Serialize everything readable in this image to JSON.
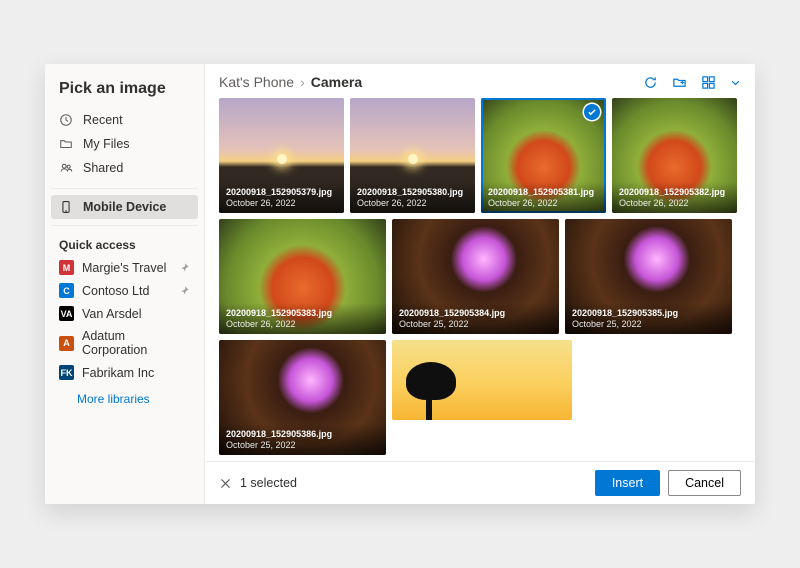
{
  "title": "Pick an image",
  "nav": {
    "recent": "Recent",
    "myfiles": "My Files",
    "shared": "Shared",
    "mobile": "Mobile Device"
  },
  "quick_access": {
    "label": "Quick access",
    "items": [
      {
        "label": "Margie's Travel",
        "tile": "M",
        "color": "#d13438",
        "pinned": true
      },
      {
        "label": "Contoso Ltd",
        "tile": "C",
        "color": "#0078d4",
        "pinned": true
      },
      {
        "label": "Van Arsdel",
        "tile": "VA",
        "color": "#000000",
        "pinned": false
      },
      {
        "label": "Adatum Corporation",
        "tile": "A",
        "color": "#ca5010",
        "pinned": false
      },
      {
        "label": "Fabrikam Inc",
        "tile": "FK",
        "color": "#004578",
        "pinned": false
      }
    ],
    "more": "More libraries"
  },
  "breadcrumb": [
    "Kat's Phone",
    "Camera"
  ],
  "thumbs": [
    {
      "name": "20200918_152905379.jpg",
      "date": "October 26, 2022",
      "art": "sunset",
      "selected": false,
      "row": 1
    },
    {
      "name": "20200918_152905380.jpg",
      "date": "October 26, 2022",
      "art": "sunset",
      "selected": false,
      "row": 1
    },
    {
      "name": "20200918_152905381.jpg",
      "date": "October 26, 2022",
      "art": "flower",
      "selected": true,
      "row": 1
    },
    {
      "name": "20200918_152905382.jpg",
      "date": "October 26, 2022",
      "art": "flower",
      "selected": false,
      "row": 1
    },
    {
      "name": "20200918_152905383.jpg",
      "date": "October 26, 2022",
      "art": "flower",
      "selected": false,
      "row": 2
    },
    {
      "name": "20200918_152905384.jpg",
      "date": "October 25, 2022",
      "art": "dome",
      "selected": false,
      "row": 2
    },
    {
      "name": "20200918_152905385.jpg",
      "date": "October 25, 2022",
      "art": "dome",
      "selected": false,
      "row": 2
    },
    {
      "name": "20200918_152905386.jpg",
      "date": "October 25, 2022",
      "art": "dome",
      "selected": false,
      "row": 2
    },
    {
      "name": "",
      "date": "",
      "art": "tree",
      "selected": false,
      "row": 3
    },
    {
      "name": "",
      "date": "",
      "art": "wall",
      "selected": false,
      "row": 3
    },
    {
      "name": "",
      "date": "",
      "art": "wall",
      "selected": false,
      "row": 3
    }
  ],
  "footer": {
    "selection": "1 selected",
    "insert": "Insert",
    "cancel": "Cancel"
  }
}
